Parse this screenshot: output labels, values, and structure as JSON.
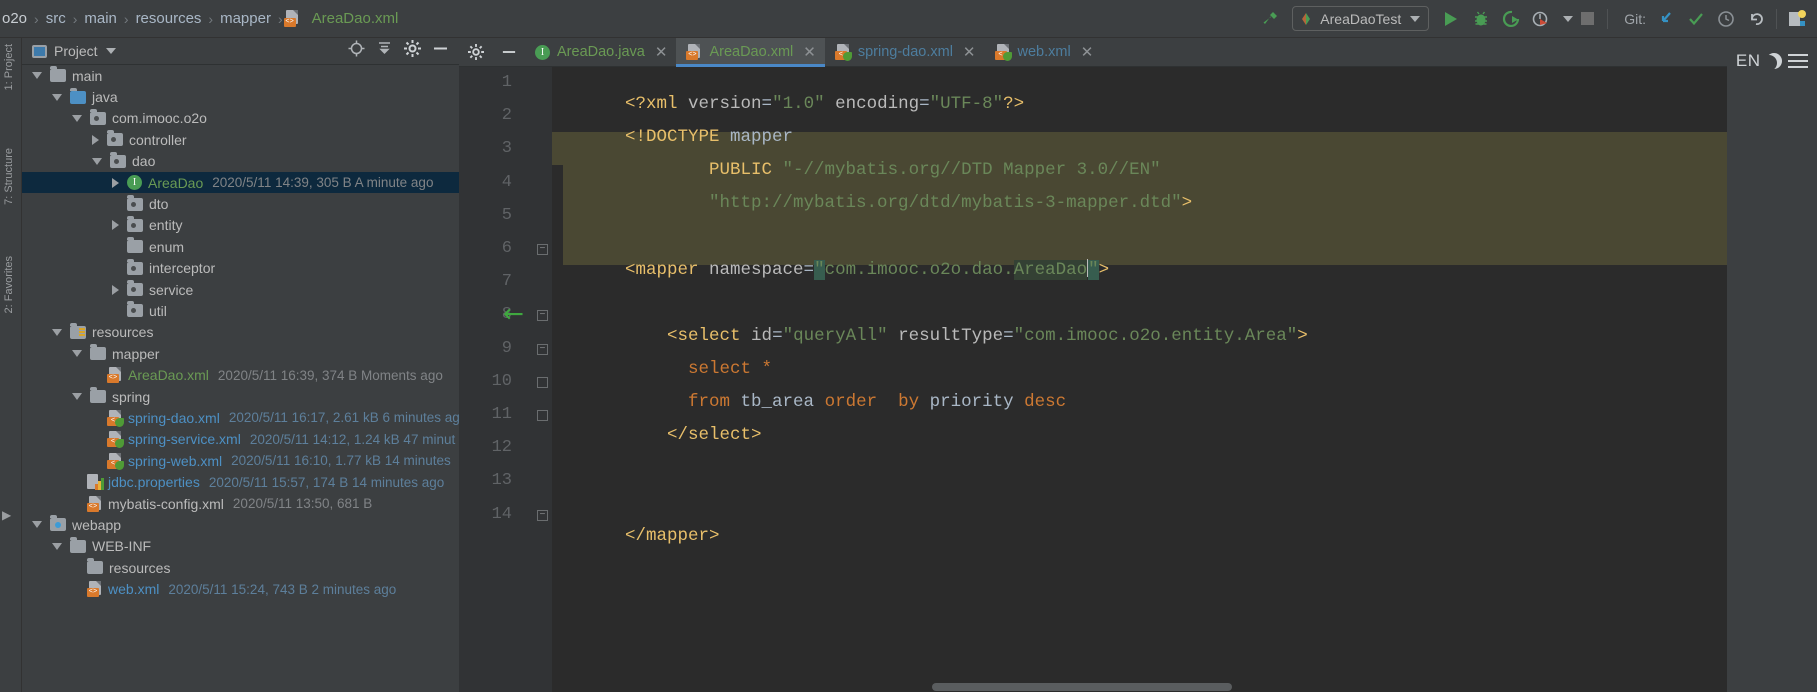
{
  "window": {
    "theme_bg": "#3c3f41",
    "editor_bg": "#2b2b2b",
    "accent": "#4a88c7"
  },
  "breadcrumb": {
    "items": [
      {
        "label": "o2o",
        "kind": "project"
      },
      {
        "label": "src",
        "kind": "folder"
      },
      {
        "label": "main",
        "kind": "folder"
      },
      {
        "label": "resources",
        "kind": "folder"
      },
      {
        "label": "mapper",
        "kind": "folder"
      },
      {
        "label": "AreaDao.xml",
        "kind": "xml-file"
      }
    ],
    "separator": "›"
  },
  "toolbar": {
    "build_icon": "hammer-icon",
    "run_configuration": "AreaDaoTest",
    "run_label": "Run",
    "debug_label": "Debug",
    "coverage_label": "Run with Coverage",
    "profile_label": "Profile",
    "stop_label": "Stop",
    "git_label": "Git:",
    "git_update_label": "Update Project",
    "git_commit_label": "Commit",
    "git_history_label": "History",
    "git_rollback_label": "Rollback",
    "search_label": "Search Everywhere"
  },
  "left_strip": {
    "items": [
      "1: Project",
      "7: Structure",
      "2: Favorites"
    ]
  },
  "right_strip": {
    "language_badge": "EN",
    "theme_toggle": "dark-mode-icon",
    "menu": "hamburger-icon"
  },
  "project_panel": {
    "title": "Project",
    "tools": [
      "locate-icon",
      "collapse-all-icon",
      "settings-icon",
      "hide-icon"
    ],
    "tree": [
      {
        "indent": 2,
        "arrow": "down",
        "icon": "folder",
        "name": "main",
        "meta": "",
        "color": "plain"
      },
      {
        "indent": 3,
        "arrow": "down",
        "icon": "folder-src",
        "name": "java",
        "meta": "",
        "color": "plain"
      },
      {
        "indent": 4,
        "arrow": "down",
        "icon": "folder-pkg",
        "name": "com.imooc.o2o",
        "meta": "",
        "color": "plain"
      },
      {
        "indent": 5,
        "arrow": "right",
        "icon": "folder-pkg",
        "name": "controller",
        "meta": "",
        "color": "plain"
      },
      {
        "indent": 5,
        "arrow": "down",
        "icon": "folder-pkg",
        "name": "dao",
        "meta": "",
        "color": "plain"
      },
      {
        "indent": 6,
        "arrow": "right",
        "icon": "java-interface",
        "name": "AreaDao",
        "meta": "2020/5/11 14:39, 305 B A minute ago",
        "color": "green",
        "selected": true
      },
      {
        "indent": 6,
        "arrow": "none",
        "icon": "folder-pkg",
        "name": "dto",
        "meta": "",
        "color": "plain"
      },
      {
        "indent": 6,
        "arrow": "right",
        "icon": "folder-pkg",
        "name": "entity",
        "meta": "",
        "color": "plain"
      },
      {
        "indent": 6,
        "arrow": "none",
        "icon": "folder",
        "name": "enum",
        "meta": "",
        "color": "plain"
      },
      {
        "indent": 6,
        "arrow": "none",
        "icon": "folder-pkg",
        "name": "interceptor",
        "meta": "",
        "color": "plain"
      },
      {
        "indent": 6,
        "arrow": "right",
        "icon": "folder-pkg",
        "name": "service",
        "meta": "",
        "color": "plain"
      },
      {
        "indent": 6,
        "arrow": "none",
        "icon": "folder-pkg",
        "name": "util",
        "meta": "",
        "color": "plain"
      },
      {
        "indent": 3,
        "arrow": "down",
        "icon": "folder-res",
        "name": "resources",
        "meta": "",
        "color": "plain"
      },
      {
        "indent": 4,
        "arrow": "down",
        "icon": "folder",
        "name": "mapper",
        "meta": "",
        "color": "plain"
      },
      {
        "indent": 5,
        "arrow": "none",
        "icon": "xml",
        "name": "AreaDao.xml",
        "meta": "2020/5/11 16:39, 374 B Moments ago",
        "color": "green"
      },
      {
        "indent": 4,
        "arrow": "down",
        "icon": "folder",
        "name": "spring",
        "meta": "",
        "color": "plain"
      },
      {
        "indent": 5,
        "arrow": "none",
        "icon": "xml-spring",
        "name": "spring-dao.xml",
        "meta": "2020/5/11 16:17, 2.61 kB 6 minutes ag",
        "color": "blue"
      },
      {
        "indent": 5,
        "arrow": "none",
        "icon": "xml-spring",
        "name": "spring-service.xml",
        "meta": "2020/5/11 14:12, 1.24 kB 47 minut",
        "color": "blue"
      },
      {
        "indent": 5,
        "arrow": "none",
        "icon": "xml-spring",
        "name": "spring-web.xml",
        "meta": "2020/5/11 16:10, 1.77 kB 14 minutes",
        "color": "blue"
      },
      {
        "indent": 4,
        "arrow": "none",
        "icon": "properties",
        "name": "jdbc.properties",
        "meta": "2020/5/11 15:57, 174 B 14 minutes ago",
        "color": "blue"
      },
      {
        "indent": 4,
        "arrow": "none",
        "icon": "xml",
        "name": "mybatis-config.xml",
        "meta": "2020/5/11 13:50, 681 B",
        "color": "plain"
      },
      {
        "indent": 2,
        "arrow": "down",
        "icon": "folder-web",
        "name": "webapp",
        "meta": "",
        "color": "plain"
      },
      {
        "indent": 3,
        "arrow": "down",
        "icon": "folder",
        "name": "WEB-INF",
        "meta": "",
        "color": "plain"
      },
      {
        "indent": 4,
        "arrow": "none",
        "icon": "folder",
        "name": "resources",
        "meta": "",
        "color": "plain"
      },
      {
        "indent": 4,
        "arrow": "none",
        "icon": "xml",
        "name": "web.xml",
        "meta": "2020/5/11 15:24, 743 B 2 minutes ago",
        "color": "blue"
      }
    ]
  },
  "editor": {
    "tabs": [
      {
        "label": "AreaDao.java",
        "icon": "java-interface-icon",
        "color": "green",
        "active": false,
        "closable": true
      },
      {
        "label": "AreaDao.xml",
        "icon": "xml-icon",
        "color": "green",
        "active": true,
        "closable": true
      },
      {
        "label": "spring-dao.xml",
        "icon": "xml-spring-icon",
        "color": "blue",
        "active": false,
        "closable": true
      },
      {
        "label": "web.xml",
        "icon": "xml-icon",
        "color": "blue",
        "active": false,
        "closable": true
      }
    ],
    "line_numbers": [
      "1",
      "2",
      "3",
      "4",
      "5",
      "6",
      "7",
      "8",
      "9",
      "10",
      "11",
      "12",
      "13",
      "14"
    ],
    "gutter_run_line": 8,
    "caret_line": 6,
    "code_lines": [
      {
        "n": 1,
        "text": "<?xml version=\"1.0\" encoding=\"UTF-8\"?>"
      },
      {
        "n": 2,
        "text": "<!DOCTYPE mapper"
      },
      {
        "n": 3,
        "text": "        PUBLIC \"-//mybatis.org//DTD Mapper 3.0//EN\""
      },
      {
        "n": 4,
        "text": "        \"http://mybatis.org/dtd/mybatis-3-mapper.dtd\">"
      },
      {
        "n": 5,
        "text": ""
      },
      {
        "n": 6,
        "text": "<mapper namespace=\"com.imooc.o2o.dao.AreaDao\">"
      },
      {
        "n": 7,
        "text": ""
      },
      {
        "n": 8,
        "text": "    <select id=\"queryAll\" resultType=\"com.imooc.o2o.entity.Area\">"
      },
      {
        "n": 9,
        "text": "      select *"
      },
      {
        "n": 10,
        "text": "      from tb_area order  by priority desc"
      },
      {
        "n": 11,
        "text": "    </select>"
      },
      {
        "n": 12,
        "text": ""
      },
      {
        "n": 13,
        "text": ""
      },
      {
        "n": 14,
        "text": "</mapper>"
      }
    ]
  }
}
